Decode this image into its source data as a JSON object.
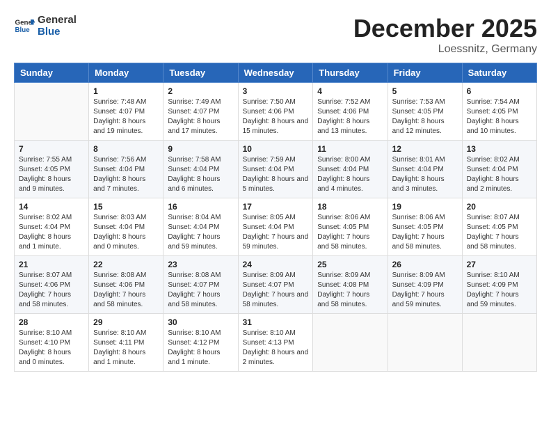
{
  "header": {
    "logo_line1": "General",
    "logo_line2": "Blue",
    "month": "December 2025",
    "location": "Loessnitz, Germany"
  },
  "weekdays": [
    "Sunday",
    "Monday",
    "Tuesday",
    "Wednesday",
    "Thursday",
    "Friday",
    "Saturday"
  ],
  "weeks": [
    [
      {
        "day": "",
        "sunrise": "",
        "sunset": "",
        "daylight": ""
      },
      {
        "day": "1",
        "sunrise": "Sunrise: 7:48 AM",
        "sunset": "Sunset: 4:07 PM",
        "daylight": "Daylight: 8 hours and 19 minutes."
      },
      {
        "day": "2",
        "sunrise": "Sunrise: 7:49 AM",
        "sunset": "Sunset: 4:07 PM",
        "daylight": "Daylight: 8 hours and 17 minutes."
      },
      {
        "day": "3",
        "sunrise": "Sunrise: 7:50 AM",
        "sunset": "Sunset: 4:06 PM",
        "daylight": "Daylight: 8 hours and 15 minutes."
      },
      {
        "day": "4",
        "sunrise": "Sunrise: 7:52 AM",
        "sunset": "Sunset: 4:06 PM",
        "daylight": "Daylight: 8 hours and 13 minutes."
      },
      {
        "day": "5",
        "sunrise": "Sunrise: 7:53 AM",
        "sunset": "Sunset: 4:05 PM",
        "daylight": "Daylight: 8 hours and 12 minutes."
      },
      {
        "day": "6",
        "sunrise": "Sunrise: 7:54 AM",
        "sunset": "Sunset: 4:05 PM",
        "daylight": "Daylight: 8 hours and 10 minutes."
      }
    ],
    [
      {
        "day": "7",
        "sunrise": "Sunrise: 7:55 AM",
        "sunset": "Sunset: 4:05 PM",
        "daylight": "Daylight: 8 hours and 9 minutes."
      },
      {
        "day": "8",
        "sunrise": "Sunrise: 7:56 AM",
        "sunset": "Sunset: 4:04 PM",
        "daylight": "Daylight: 8 hours and 7 minutes."
      },
      {
        "day": "9",
        "sunrise": "Sunrise: 7:58 AM",
        "sunset": "Sunset: 4:04 PM",
        "daylight": "Daylight: 8 hours and 6 minutes."
      },
      {
        "day": "10",
        "sunrise": "Sunrise: 7:59 AM",
        "sunset": "Sunset: 4:04 PM",
        "daylight": "Daylight: 8 hours and 5 minutes."
      },
      {
        "day": "11",
        "sunrise": "Sunrise: 8:00 AM",
        "sunset": "Sunset: 4:04 PM",
        "daylight": "Daylight: 8 hours and 4 minutes."
      },
      {
        "day": "12",
        "sunrise": "Sunrise: 8:01 AM",
        "sunset": "Sunset: 4:04 PM",
        "daylight": "Daylight: 8 hours and 3 minutes."
      },
      {
        "day": "13",
        "sunrise": "Sunrise: 8:02 AM",
        "sunset": "Sunset: 4:04 PM",
        "daylight": "Daylight: 8 hours and 2 minutes."
      }
    ],
    [
      {
        "day": "14",
        "sunrise": "Sunrise: 8:02 AM",
        "sunset": "Sunset: 4:04 PM",
        "daylight": "Daylight: 8 hours and 1 minute."
      },
      {
        "day": "15",
        "sunrise": "Sunrise: 8:03 AM",
        "sunset": "Sunset: 4:04 PM",
        "daylight": "Daylight: 8 hours and 0 minutes."
      },
      {
        "day": "16",
        "sunrise": "Sunrise: 8:04 AM",
        "sunset": "Sunset: 4:04 PM",
        "daylight": "Daylight: 7 hours and 59 minutes."
      },
      {
        "day": "17",
        "sunrise": "Sunrise: 8:05 AM",
        "sunset": "Sunset: 4:04 PM",
        "daylight": "Daylight: 7 hours and 59 minutes."
      },
      {
        "day": "18",
        "sunrise": "Sunrise: 8:06 AM",
        "sunset": "Sunset: 4:05 PM",
        "daylight": "Daylight: 7 hours and 58 minutes."
      },
      {
        "day": "19",
        "sunrise": "Sunrise: 8:06 AM",
        "sunset": "Sunset: 4:05 PM",
        "daylight": "Daylight: 7 hours and 58 minutes."
      },
      {
        "day": "20",
        "sunrise": "Sunrise: 8:07 AM",
        "sunset": "Sunset: 4:05 PM",
        "daylight": "Daylight: 7 hours and 58 minutes."
      }
    ],
    [
      {
        "day": "21",
        "sunrise": "Sunrise: 8:07 AM",
        "sunset": "Sunset: 4:06 PM",
        "daylight": "Daylight: 7 hours and 58 minutes."
      },
      {
        "day": "22",
        "sunrise": "Sunrise: 8:08 AM",
        "sunset": "Sunset: 4:06 PM",
        "daylight": "Daylight: 7 hours and 58 minutes."
      },
      {
        "day": "23",
        "sunrise": "Sunrise: 8:08 AM",
        "sunset": "Sunset: 4:07 PM",
        "daylight": "Daylight: 7 hours and 58 minutes."
      },
      {
        "day": "24",
        "sunrise": "Sunrise: 8:09 AM",
        "sunset": "Sunset: 4:07 PM",
        "daylight": "Daylight: 7 hours and 58 minutes."
      },
      {
        "day": "25",
        "sunrise": "Sunrise: 8:09 AM",
        "sunset": "Sunset: 4:08 PM",
        "daylight": "Daylight: 7 hours and 58 minutes."
      },
      {
        "day": "26",
        "sunrise": "Sunrise: 8:09 AM",
        "sunset": "Sunset: 4:09 PM",
        "daylight": "Daylight: 7 hours and 59 minutes."
      },
      {
        "day": "27",
        "sunrise": "Sunrise: 8:10 AM",
        "sunset": "Sunset: 4:09 PM",
        "daylight": "Daylight: 7 hours and 59 minutes."
      }
    ],
    [
      {
        "day": "28",
        "sunrise": "Sunrise: 8:10 AM",
        "sunset": "Sunset: 4:10 PM",
        "daylight": "Daylight: 8 hours and 0 minutes."
      },
      {
        "day": "29",
        "sunrise": "Sunrise: 8:10 AM",
        "sunset": "Sunset: 4:11 PM",
        "daylight": "Daylight: 8 hours and 1 minute."
      },
      {
        "day": "30",
        "sunrise": "Sunrise: 8:10 AM",
        "sunset": "Sunset: 4:12 PM",
        "daylight": "Daylight: 8 hours and 1 minute."
      },
      {
        "day": "31",
        "sunrise": "Sunrise: 8:10 AM",
        "sunset": "Sunset: 4:13 PM",
        "daylight": "Daylight: 8 hours and 2 minutes."
      },
      {
        "day": "",
        "sunrise": "",
        "sunset": "",
        "daylight": ""
      },
      {
        "day": "",
        "sunrise": "",
        "sunset": "",
        "daylight": ""
      },
      {
        "day": "",
        "sunrise": "",
        "sunset": "",
        "daylight": ""
      }
    ]
  ]
}
